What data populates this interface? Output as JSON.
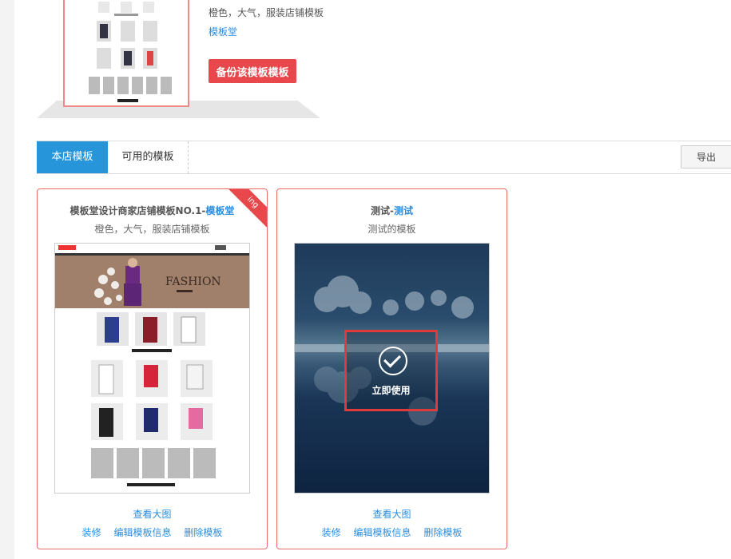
{
  "top": {
    "desc": "橙色，大气，服装店铺模板",
    "link": "模板堂",
    "backup_button": "备份该模板模板"
  },
  "tabs": {
    "active": "本店模板",
    "other": "可用的模板",
    "export": "导出"
  },
  "cards": [
    {
      "title_main": "模板堂设计商家店铺模板NO.1-",
      "title_highlight": "模板堂",
      "subtitle": "橙色，大气，服装店铺模板",
      "ribbon": "ing",
      "view_big": "查看大图",
      "actions": [
        "装修",
        "编辑模板信息",
        "删除模板"
      ]
    },
    {
      "title_main": "测试-",
      "title_highlight": "测试",
      "subtitle": "测试的模板",
      "use_now": "立即使用",
      "view_big": "查看大图",
      "actions": [
        "装修",
        "编辑模板信息",
        "删除模板"
      ]
    }
  ],
  "colors": {
    "primary_blue": "#2695d9",
    "link_blue": "#2a8de0",
    "accent_red": "#e8484b",
    "card_border": "#e86a6a"
  }
}
